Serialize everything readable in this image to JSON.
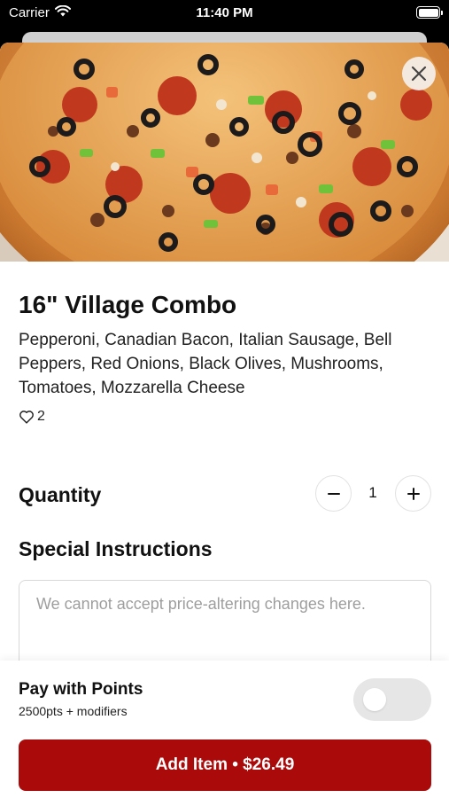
{
  "status_bar": {
    "carrier": "Carrier",
    "time": "11:40 PM"
  },
  "item": {
    "title": "16\" Village Combo",
    "description": "Pepperoni, Canadian Bacon, Italian Sausage, Bell Peppers, Red Onions, Black Olives, Mushrooms, Tomatoes, Mozzarella Cheese",
    "likes": "2"
  },
  "quantity": {
    "label": "Quantity",
    "value": "1"
  },
  "special_instructions": {
    "label": "Special Instructions",
    "value": "",
    "placeholder": "We cannot accept price-altering changes here."
  },
  "pay_with_points": {
    "title": "Pay with Points",
    "subtitle": "2500pts + modifiers",
    "enabled": false
  },
  "add_button": {
    "label": "Add Item • $26.49"
  },
  "colors": {
    "accent": "#ab0a0a",
    "toggle_off": "#e6e6e6"
  },
  "icons": {
    "close": "close-icon",
    "heart": "heart-icon",
    "minus": "minus-icon",
    "plus": "plus-icon",
    "wifi": "wifi-icon",
    "battery": "battery-icon"
  }
}
